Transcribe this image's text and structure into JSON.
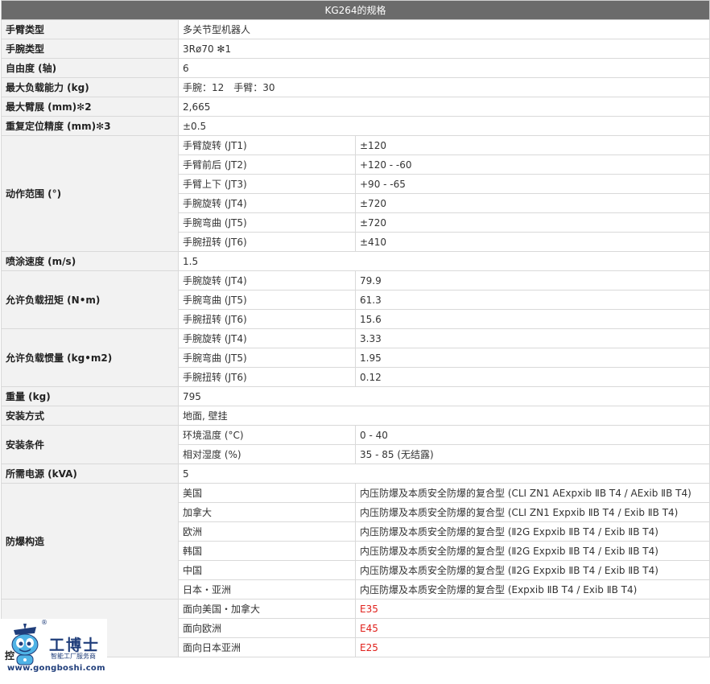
{
  "title": "KG264的规格",
  "rows": {
    "arm_type": {
      "label": "手臂类型",
      "value": "多关节型机器人"
    },
    "wrist_type": {
      "label": "手腕类型",
      "value": "3Rø70 ✻1"
    },
    "dof": {
      "label": "自由度 (轴)",
      "value": "6"
    },
    "payload": {
      "label": "最大负载能力 (kg)",
      "value": "手腕：12　手臂：30"
    },
    "reach": {
      "label": "最大臂展 (mm)✻2",
      "value": "2,665"
    },
    "repeatability": {
      "label": "重复定位精度 (mm)✻3",
      "value": "±0.5"
    },
    "motion_range": {
      "label": "动作范围 (°)",
      "items": [
        {
          "axis": "手臂旋转 (JT1)",
          "value": "±120"
        },
        {
          "axis": "手臂前后 (JT2)",
          "value": "+120 - -60"
        },
        {
          "axis": "手臂上下 (JT3)",
          "value": "+90 - -65"
        },
        {
          "axis": "手腕旋转 (JT4)",
          "value": "±720"
        },
        {
          "axis": "手腕弯曲 (JT5)",
          "value": "±720"
        },
        {
          "axis": "手腕扭转 (JT6)",
          "value": "±410"
        }
      ]
    },
    "spray_speed": {
      "label": "喷涂速度 (m/s)",
      "value": "1.5"
    },
    "torque": {
      "label": "允许负载扭矩 (N•m)",
      "items": [
        {
          "axis": "手腕旋转 (JT4)",
          "value": "79.9"
        },
        {
          "axis": "手腕弯曲 (JT5)",
          "value": "61.3"
        },
        {
          "axis": "手腕扭转 (JT6)",
          "value": "15.6"
        }
      ]
    },
    "inertia": {
      "label": "允许负载惯量 (kg•m2)",
      "items": [
        {
          "axis": "手腕旋转 (JT4)",
          "value": "3.33"
        },
        {
          "axis": "手腕弯曲 (JT5)",
          "value": "1.95"
        },
        {
          "axis": "手腕扭转 (JT6)",
          "value": "0.12"
        }
      ]
    },
    "weight": {
      "label": "重量 (kg)",
      "value": "795"
    },
    "mounting": {
      "label": "安装方式",
      "value": "地面, 壁挂"
    },
    "environment": {
      "label": "安装条件",
      "items": [
        {
          "axis": "环境温度 (°C)",
          "value": "0 - 40"
        },
        {
          "axis": "相对湿度 (%)",
          "value": "35 - 85 (无结露)"
        }
      ]
    },
    "power": {
      "label": "所需电源 (kVA)",
      "value": "5"
    },
    "explosion": {
      "label": "防爆构造",
      "items": [
        {
          "axis": "美国",
          "value": "内压防爆及本质安全防爆的复合型 (CLI ZN1 AExpxib ⅡB T4 / AExib ⅡB T4)"
        },
        {
          "axis": "加拿大",
          "value": "内压防爆及本质安全防爆的复合型 (CLI ZN1 Expxib ⅡB T4 / Exib ⅡB T4)"
        },
        {
          "axis": "欧洲",
          "value": "内压防爆及本质安全防爆的复合型 (Ⅱ2G Expxib ⅡB T4 / Exib ⅡB T4)"
        },
        {
          "axis": "韩国",
          "value": "内压防爆及本质安全防爆的复合型 (Ⅱ2G Expxib ⅡB T4 / Exib ⅡB T4)"
        },
        {
          "axis": "中国",
          "value": "内压防爆及本质安全防爆的复合型 (Ⅱ2G Expxib ⅡB T4 / Exib ⅡB T4)"
        },
        {
          "axis": "日本・亚洲",
          "value": "内压防爆及本质安全防爆的复合型 (Expxib ⅡB T4 / Exib ⅡB T4)"
        }
      ]
    },
    "controller": {
      "label_partial": "控",
      "items": [
        {
          "axis": "面向美国・加拿大",
          "value": "E35"
        },
        {
          "axis": "面向欧洲",
          "value": "E45"
        },
        {
          "axis": "面向日本亚洲",
          "value": "E25"
        }
      ]
    }
  },
  "watermark": {
    "brand": "工博士",
    "tagline": "智能工厂服务商",
    "url": "www.gongboshi.com",
    "reg": "®"
  },
  "colors": {
    "header_bg": "#6b6b6b",
    "label_bg": "#f2f2f2",
    "border": "#d9d9d9",
    "highlight": "#e0201b",
    "brand": "#1f3d7a"
  }
}
